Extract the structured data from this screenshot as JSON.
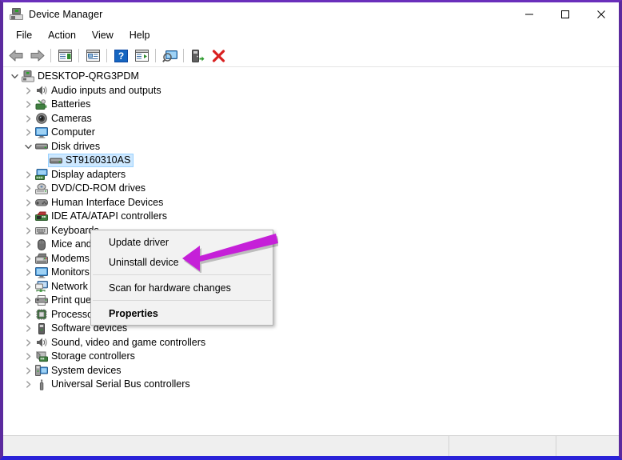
{
  "window": {
    "title": "Device Manager",
    "icon": "device-manager-icon",
    "border_color": "#5b2a9e",
    "bottom_border_color": "#2a22d8",
    "controls": [
      {
        "name": "minimize-button",
        "glyph": "minimize-icon"
      },
      {
        "name": "maximize-button",
        "glyph": "maximize-icon"
      },
      {
        "name": "close-button",
        "glyph": "close-icon"
      }
    ]
  },
  "menubar": {
    "items": [
      {
        "label": "File"
      },
      {
        "label": "Action"
      },
      {
        "label": "View"
      },
      {
        "label": "Help"
      }
    ]
  },
  "toolbar": {
    "buttons": [
      {
        "name": "back-button",
        "icon": "back-arrow-icon"
      },
      {
        "name": "forward-button",
        "icon": "forward-arrow-icon"
      },
      {
        "name": "separator-1",
        "icon": "separator"
      },
      {
        "name": "show-hide-console-tree-button",
        "icon": "console-tree-icon"
      },
      {
        "name": "separator-2",
        "icon": "separator"
      },
      {
        "name": "properties-button",
        "icon": "properties-icon"
      },
      {
        "name": "separator-3",
        "icon": "separator"
      },
      {
        "name": "help-button",
        "icon": "question-mark-icon"
      },
      {
        "name": "show-action-pane-button",
        "icon": "action-pane-icon"
      },
      {
        "name": "separator-4",
        "icon": "separator"
      },
      {
        "name": "scan-for-hardware-changes-button",
        "icon": "scan-monitor-icon"
      },
      {
        "name": "separator-5",
        "icon": "separator"
      },
      {
        "name": "update-driver-button",
        "icon": "update-driver-icon"
      },
      {
        "name": "uninstall-device-button",
        "icon": "red-x-icon"
      }
    ]
  },
  "tree": {
    "root": {
      "label": "DESKTOP-QRG3PDM",
      "icon": "computer-root-icon",
      "expanded": true
    },
    "items": [
      {
        "label": "Audio inputs and outputs",
        "icon": "speaker-icon",
        "expanded": false,
        "level": 1
      },
      {
        "label": "Batteries",
        "icon": "battery-icon",
        "expanded": false,
        "level": 1
      },
      {
        "label": "Cameras",
        "icon": "camera-icon",
        "expanded": false,
        "level": 1
      },
      {
        "label": "Computer",
        "icon": "monitor-icon",
        "expanded": false,
        "level": 1
      },
      {
        "label": "Disk drives",
        "icon": "disk-drive-icon",
        "expanded": true,
        "level": 1
      },
      {
        "label": "ST9160310AS",
        "icon": "disk-drive-icon",
        "level": 2,
        "selected": true
      },
      {
        "label": "Display adapters",
        "icon": "display-adapter-icon",
        "expanded": false,
        "level": 1
      },
      {
        "label": "DVD/CD-ROM drives",
        "icon": "dvd-drive-icon",
        "expanded": false,
        "level": 1
      },
      {
        "label": "Human Interface Devices",
        "icon": "gamepad-icon",
        "expanded": false,
        "level": 1
      },
      {
        "label": "IDE ATA/ATAPI controllers",
        "icon": "ide-controller-icon",
        "expanded": false,
        "level": 1
      },
      {
        "label": "Keyboards",
        "icon": "keyboard-icon",
        "expanded": false,
        "level": 1
      },
      {
        "label": "Mice and other pointing devices",
        "icon": "mouse-icon",
        "expanded": false,
        "level": 1
      },
      {
        "label": "Modems",
        "icon": "modem-icon",
        "expanded": false,
        "level": 1
      },
      {
        "label": "Monitors",
        "icon": "monitor-icon",
        "expanded": false,
        "level": 1
      },
      {
        "label": "Network adapters",
        "icon": "network-adapter-icon",
        "expanded": false,
        "level": 1
      },
      {
        "label": "Print queues",
        "icon": "printer-icon",
        "expanded": false,
        "level": 1
      },
      {
        "label": "Processors",
        "icon": "processor-icon",
        "expanded": false,
        "level": 1
      },
      {
        "label": "Software devices",
        "icon": "software-device-icon",
        "expanded": false,
        "level": 1
      },
      {
        "label": "Sound, video and game controllers",
        "icon": "speaker-icon",
        "expanded": false,
        "level": 1
      },
      {
        "label": "Storage controllers",
        "icon": "storage-controller-icon",
        "expanded": false,
        "level": 1
      },
      {
        "label": "System devices",
        "icon": "system-device-icon",
        "expanded": false,
        "level": 1
      },
      {
        "label": "Universal Serial Bus controllers",
        "icon": "usb-icon",
        "expanded": false,
        "level": 1
      }
    ]
  },
  "context_menu": {
    "items": [
      {
        "label": "Update driver",
        "bold": false,
        "type": "item"
      },
      {
        "label": "Uninstall device",
        "bold": false,
        "type": "item"
      },
      {
        "type": "separator"
      },
      {
        "label": "Scan for hardware changes",
        "bold": false,
        "type": "item"
      },
      {
        "type": "separator"
      },
      {
        "label": "Properties",
        "bold": true,
        "type": "item"
      }
    ]
  },
  "annotation": {
    "arrow": {
      "name": "magenta-arrow-annotation",
      "color": "#c520d8",
      "points_to": "Uninstall device"
    }
  },
  "statusbar": {
    "pane1": "",
    "pane2": "",
    "pane3": ""
  }
}
